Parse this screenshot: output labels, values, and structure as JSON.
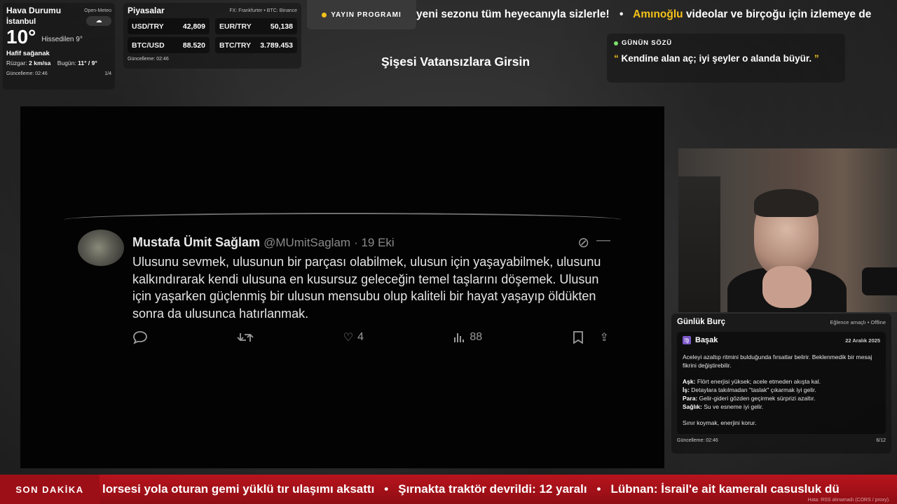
{
  "weather": {
    "title": "Hava Durumu",
    "source": "Open-Meteo",
    "city": "İstanbul",
    "icon": "cloud-icon",
    "temperature": "10°",
    "feels_like": "Hissedilen 9°",
    "condition": "Hafif sağanak",
    "wind_label": "Rüzgar:",
    "wind_value": "2 km/sa",
    "today_label": "Bugün:",
    "today_value": "11° / 9°",
    "updated": "Güncelleme: 02:46",
    "page": "1/4"
  },
  "markets": {
    "title": "Piyasalar",
    "source": "FX: Frankfurter • BTC: Binance",
    "items": [
      {
        "label": "USD/TRY",
        "value": "42,809"
      },
      {
        "label": "EUR/TRY",
        "value": "50,138"
      },
      {
        "label": "BTC/USD",
        "value": "88.520"
      },
      {
        "label": "BTC/TRY",
        "value": "3.789.453"
      }
    ],
    "updated": "Güncelleme: 02:46"
  },
  "schedule_button": "YAYIN PROGRAMI",
  "top_ticker": {
    "part1": "yeni sezonu tüm heyecanıyla sizlerle!",
    "highlight": "Amınoğlu",
    "part2": "videolar ve birçoğu için izlemeye de"
  },
  "stream_title": "Şişesi Vatansızlara Girsin",
  "quote": {
    "heading": "GÜNÜN SÖZÜ",
    "open_mark": "“",
    "text": "Kendine alan aç; iyi şeyler o alanda büyür.",
    "close_mark": "”"
  },
  "tweet": {
    "name": "Mustafa Ümit Sağlam",
    "handle": "@MUmitSaglam",
    "date": "· 19 Eki",
    "text": "Ulusunu sevmek, ulusunun bir parçası olabilmek, ulusun için yaşayabilmek, ulusunu kalkındırarak kendi ulusuna en kusursuz geleceğin temel taşlarını döşemek. Ulusun için yaşarken güçlenmiş bir ulusun mensubu olup kaliteli bir hayat yaşayıp öldükten sonra da ulusunca hatırlanmak.",
    "likes": "4",
    "views": "88"
  },
  "horoscope": {
    "title": "Günlük Burç",
    "meta": "Eğlence amaçlı • Offline",
    "sign": "Başak",
    "sign_symbol": "♍",
    "date": "22 Aralık 2025",
    "summary": "Aceleyi azaltıp ritmini bulduğunda fırsatlar belirir. Beklenmedik bir mesaj fikrini değiştirebilir.",
    "lines": [
      {
        "label": "Aşk:",
        "text": "Flört enerjisi yüksek; acele etmeden akışta kal."
      },
      {
        "label": "İş:",
        "text": "Detaylara takılmadan \"taslak\" çıkarmak iyi gelir."
      },
      {
        "label": "Para:",
        "text": "Gelir-gideri gözden geçirmek sürprizi azaltır."
      },
      {
        "label": "Sağlık:",
        "text": "Su ve esneme iyi gelir."
      }
    ],
    "closing": "Sınır koymak, enerjini korur.",
    "updated": "Güncelleme: 02:46",
    "page": "6/12"
  },
  "breaking": {
    "label": "SON DAKİKA",
    "items": [
      "lorsesi yola oturan gemi yüklü tır ulaşımı aksattı",
      "Şırnakta traktör devrildi: 12 yaralı",
      "Lübnan: İsrail'e ait kameralı casusluk dü"
    ],
    "error": "Hata: RSS alınamadı (CORS / proxy)."
  },
  "colors": {
    "accent": "#f4c21a",
    "breaking_red": "#b8141d",
    "live_dot": "#7ee06c"
  }
}
